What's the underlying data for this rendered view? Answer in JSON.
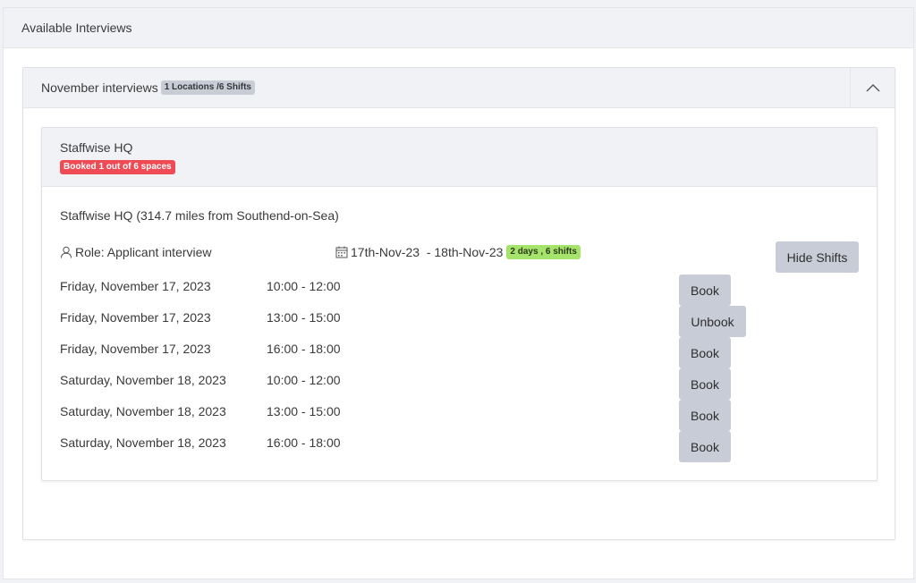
{
  "page": {
    "title": "Available Interviews"
  },
  "group": {
    "title": "November interviews",
    "badge": "1 Locations /6 Shifts",
    "toggle_icon": "chevron-up-icon"
  },
  "location": {
    "name": "Staffwise HQ",
    "booking_badge": "Booked 1 out of 6 spaces",
    "address": "Staffwise HQ (314.7 miles from Southend-on-Sea)",
    "role": "Role: Applicant interview",
    "date_range": "17th-Nov-23  - 18th-Nov-23",
    "days_badge": "2 days , 6 shifts",
    "hide_label": "Hide Shifts",
    "role_icon": "user-icon",
    "date_icon": "calendar-icon"
  },
  "shifts": [
    {
      "date": "Friday, November 17, 2023",
      "time": "10:00 - 12:00",
      "action": "Book"
    },
    {
      "date": "Friday, November 17, 2023",
      "time": "13:00 - 15:00",
      "action": "Unbook"
    },
    {
      "date": "Friday, November 17, 2023",
      "time": "16:00 - 18:00",
      "action": "Book"
    },
    {
      "date": "Saturday, November 18, 2023",
      "time": "10:00 - 12:00",
      "action": "Book"
    },
    {
      "date": "Saturday, November 18, 2023",
      "time": "13:00 - 15:00",
      "action": "Book"
    },
    {
      "date": "Saturday, November 18, 2023",
      "time": "16:00 - 18:00",
      "action": "Book"
    }
  ],
  "colors": {
    "badge_red": "#ef4b55",
    "badge_green": "#a6e36b",
    "badge_grey": "#c8ccd4",
    "button": "#c8ccd6"
  }
}
